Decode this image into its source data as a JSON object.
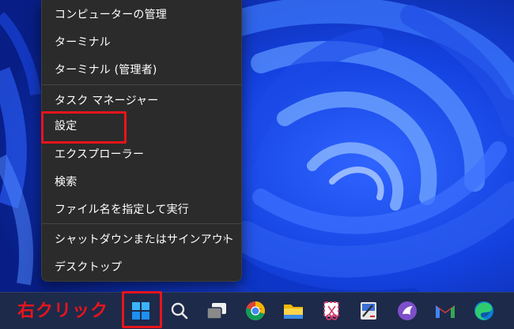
{
  "menu": {
    "items": [
      {
        "label": "コンピューターの管理"
      },
      {
        "label": "ターミナル"
      },
      {
        "label": "ターミナル (管理者)"
      },
      {
        "label": "タスク マネージャー"
      },
      {
        "label": "設定"
      },
      {
        "label": "エクスプローラー"
      },
      {
        "label": "検索"
      },
      {
        "label": "ファイル名を指定して実行"
      },
      {
        "label": "シャットダウンまたはサインアウト",
        "submenu_arrow": "›"
      },
      {
        "label": "デスクトップ"
      }
    ]
  },
  "annotation": {
    "label": "右クリック",
    "color": "#e8141c"
  },
  "taskbar": {
    "icons": [
      "windows-start-icon",
      "search-icon",
      "task-view-icon",
      "chrome-icon",
      "file-explorer-icon",
      "snipping-tool-icon",
      "paint-icon",
      "wing-app-icon",
      "gmail-icon",
      "edge-icon"
    ]
  },
  "colors": {
    "menu_bg": "#2b2b2b",
    "highlight": "#e8141c",
    "wallpaper": "#0a2fb8"
  }
}
